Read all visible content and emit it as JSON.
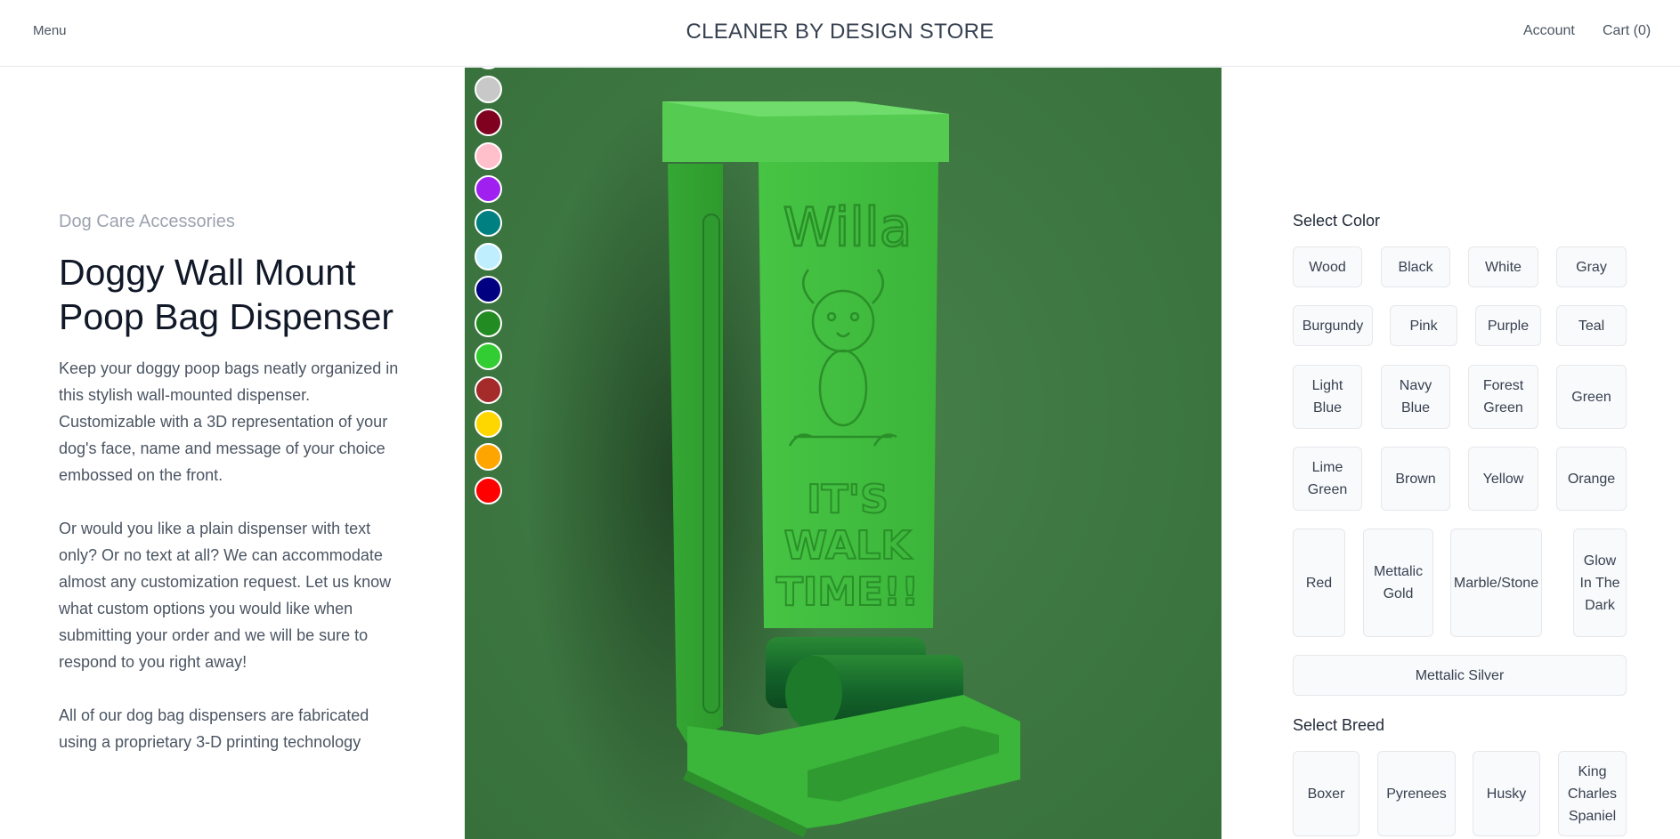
{
  "header": {
    "menu": "Menu",
    "brand": "CLEANER BY DESIGN STORE",
    "account": "Account",
    "cart": "Cart (0)"
  },
  "product": {
    "category": "Dog Care Accessories",
    "title": "Doggy Wall Mount Poop Bag Dispenser",
    "description": [
      "Keep your doggy poop bags neatly organized in this stylish wall-mounted dispenser. Customizable with a 3D representation of your dog's face, name and message of your choice embossed on the front.",
      "Or would you like a plain dispenser with text only? Or no text at all? We can accommodate almost any customization request. Let us know what custom options you would like when submitting your order and we will be sure to respond to you right away!",
      "All of our dog bag dispensers are fabricated using a proprietary 3-D printing technology"
    ]
  },
  "image": {
    "engraving_name": "Willa",
    "engraving_message": [
      "IT'S",
      "WALK",
      "TIME!!"
    ],
    "product_color": "#3bb53a"
  },
  "swatches": [
    "#ffffff",
    "#c8c8c8",
    "#800020",
    "#ffc0cb",
    "#a020f0",
    "#008080",
    "#bfefff",
    "#000080",
    "#228b22",
    "#32cd32",
    "#a52a2a",
    "#ffd700",
    "#ffa500",
    "#ff0000"
  ],
  "color_options": {
    "label": "Select Color",
    "items": [
      "Wood",
      "Black",
      "White",
      "Gray",
      "Burgundy",
      "Pink",
      "Purple",
      "Teal",
      "Light Blue",
      "Navy Blue",
      "Forest Green",
      "Green",
      "Lime Green",
      "Brown",
      "Yellow",
      "Orange",
      "Red",
      "Mettalic Gold",
      "Marble/Stone",
      "Glow In The Dark",
      "Mettalic Silver"
    ]
  },
  "breed_options": {
    "label": "Select Breed",
    "items": [
      "Boxer",
      "Pyrenees",
      "Husky",
      "King Charles Spaniel"
    ]
  }
}
